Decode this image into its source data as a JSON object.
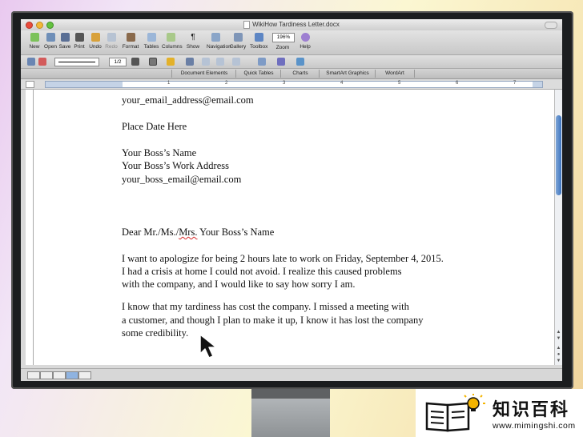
{
  "window": {
    "title": "WikiHow Tardiness Letter.docx"
  },
  "toolbar": {
    "items": [
      "New",
      "Open",
      "Save",
      "Print",
      "Undo",
      "Redo",
      "Format",
      "Tables",
      "Columns",
      "Show",
      "Navigation",
      "Gallery",
      "Toolbox"
    ],
    "zoom_value": "196%",
    "zoom_label": "Zoom",
    "help_label": "Help"
  },
  "formatbar": {
    "line_weight": "1/2"
  },
  "ribbon": {
    "tabs": [
      "Document Elements",
      "Quick Tables",
      "Charts",
      "SmartArt Graphics",
      "WordArt"
    ]
  },
  "ruler": {
    "labels": [
      "1",
      "2",
      "3",
      "4",
      "5",
      "6",
      "7"
    ]
  },
  "document": {
    "lines": [
      "your_email_address@email.com",
      "Place Date Here",
      "Your Boss’s Name",
      "Your Boss’s Work Address",
      "your_boss_email@email.com",
      "Dear Mr./Ms./",
      "Mrs.",
      " Your Boss’s Name",
      "I want to apologize for being 2 hours late to work on Friday, September 4, 2015.",
      "I had a crisis at home I could not avoid. I realize this caused problems",
      "with the company, and I would like to say how sorry I am.",
      "I know that my tardiness has cost the company. I missed a meeting with",
      "a customer, and though I plan to make it up, I know it has lost the company",
      "some credibility."
    ]
  },
  "logo": {
    "title": "知识百科",
    "url": "www.mimingshi.com"
  },
  "colors": {
    "accent": "#3d74c0",
    "background": "#f6efc8",
    "bezel": "#1b1d1f"
  }
}
